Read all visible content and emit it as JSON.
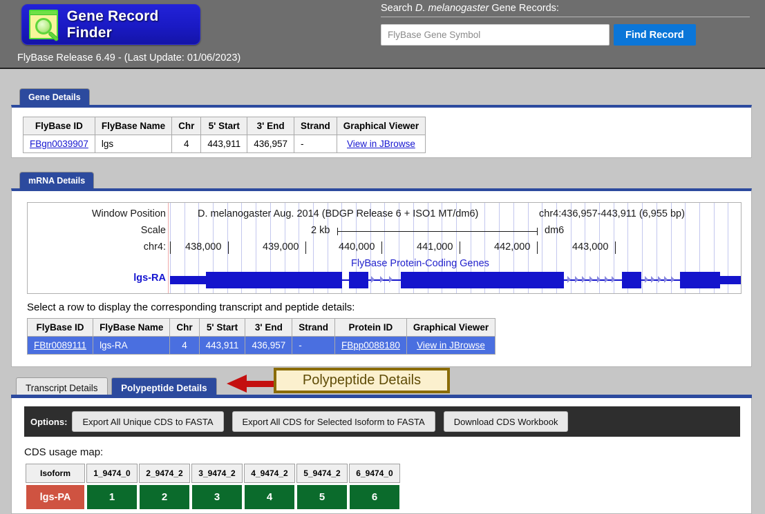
{
  "header": {
    "logo_text": "Gene Record Finder",
    "logo_icon": "magnifier-icon",
    "release_line": "FlyBase Release 6.49 - (Last Update: 01/06/2023)",
    "search_label_pre": "Search ",
    "search_label_species": "D. melanogaster",
    "search_label_post": " Gene Records:",
    "search_placeholder": "FlyBase Gene Symbol",
    "search_value": "",
    "find_button": "Find Record",
    "accent_blue": "#0b76d8",
    "bar_background": "#6e6e6e"
  },
  "gene_panel": {
    "tab_label": "Gene Details",
    "columns": [
      "FlyBase ID",
      "FlyBase Name",
      "Chr",
      "5' Start",
      "3' End",
      "Strand",
      "Graphical Viewer"
    ],
    "rows": [
      {
        "flybase_id": "FBgn0039907",
        "flybase_name": "lgs",
        "chr": "4",
        "start": "443,911",
        "end": "436,957",
        "strand": "-",
        "viewer": "View in JBrowse"
      }
    ]
  },
  "mrna_panel": {
    "tab_label": "mRNA Details",
    "viewer": {
      "row_labels": [
        "Window Position",
        "Scale",
        "chr4:"
      ],
      "assembly_title": "D. melanogaster Aug. 2014 (BDGP Release 6 + ISO1 MT/dm6)",
      "region_title": "chr4:436,957-443,911 (6,955 bp)",
      "scale_value": "2 kb",
      "assembly_short": "dm6",
      "coord_ticks": [
        "438,000",
        "439,000",
        "440,000",
        "441,000",
        "442,000",
        "443,000"
      ],
      "track_title": "FlyBase Protein-Coding Genes",
      "gene_label": "lgs-RA",
      "gene_color": "#1414cc",
      "gridline_color": "#c3c7ee",
      "window_marker_color": "#f0a8a8"
    },
    "select_hint": "Select a row to display the corresponding transcript and peptide details:",
    "columns": [
      "FlyBase ID",
      "FlyBase Name",
      "Chr",
      "5' Start",
      "3' End",
      "Strand",
      "Protein ID",
      "Graphical Viewer"
    ],
    "rows": [
      {
        "flybase_id": "FBtr0089111",
        "flybase_name": "lgs-RA",
        "chr": "4",
        "start": "443,911",
        "end": "436,957",
        "strand": "-",
        "protein_id": "FBpp0088180",
        "viewer": "View in JBrowse",
        "selected": true
      }
    ],
    "selected_row_color": "#4a6fe0"
  },
  "detail_tabs": {
    "tabs": [
      {
        "label": "Transcript Details",
        "active": false
      },
      {
        "label": "Polypeptide Details",
        "active": true
      }
    ],
    "active_color": "#2c4a9e"
  },
  "annotation": {
    "arrow_icon": "left-arrow-icon",
    "arrow_color": "#c41010",
    "label": "Polypeptide Details",
    "box_background": "#fbf0ce",
    "box_border": "#8a6c08",
    "text_color": "#5f4c07"
  },
  "polypeptide_panel": {
    "options_label": "Options:",
    "options_background": "#2e2e2e",
    "buttons": [
      "Export All Unique CDS to FASTA",
      "Export All CDS for Selected Isoform to FASTA",
      "Download CDS Workbook"
    ],
    "cds_map_title": "CDS usage map:",
    "cds_columns": [
      "Isoform",
      "1_9474_0",
      "2_9474_2",
      "3_9474_2",
      "4_9474_2",
      "5_9474_2",
      "6_9474_0"
    ],
    "cds_rows": [
      {
        "isoform": "lgs-PA",
        "cells": [
          "1",
          "2",
          "3",
          "4",
          "5",
          "6"
        ]
      }
    ],
    "isoform_cell_color": "#cf5341",
    "used_cell_color": "#0b6b2c"
  }
}
